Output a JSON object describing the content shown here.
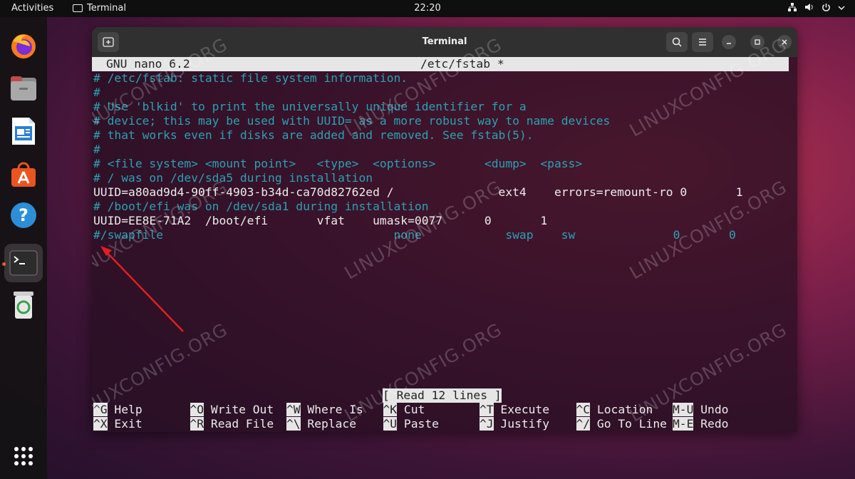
{
  "topbar": {
    "activities": "Activities",
    "app_name": "Terminal",
    "clock": "22:20"
  },
  "dock": {
    "items": [
      "Firefox",
      "Files",
      "LibreOffice Writer",
      "Ubuntu Software",
      "Help",
      "Terminal",
      "Trash"
    ]
  },
  "window": {
    "title": "Terminal"
  },
  "nano": {
    "version": "GNU nano 6.2",
    "filename": "/etc/fstab *",
    "lines": [
      "# /etc/fstab: static file system information.",
      "#",
      "# Use 'blkid' to print the universally unique identifier for a",
      "# device; this may be used with UUID= as a more robust way to name devices",
      "# that works even if disks are added and removed. See fstab(5).",
      "#",
      "# <file system> <mount point>   <type>  <options>       <dump>  <pass>",
      "# / was on /dev/sda5 during installation",
      "UUID=a80ad9d4-90ff-4903-b34d-ca70d82762ed /               ext4    errors=remount-ro 0       1",
      "# /boot/efi was on /dev/sda1 during installation",
      "UUID=EE8E-71A2  /boot/efi       vfat    umask=0077      0       1",
      "#/swapfile                                 none            swap    sw              0       0"
    ],
    "status": "[ Read 12 lines ]",
    "shortcuts_row1": [
      {
        "key": "^G",
        "label": "Help"
      },
      {
        "key": "^O",
        "label": "Write Out"
      },
      {
        "key": "^W",
        "label": "Where Is"
      },
      {
        "key": "^K",
        "label": "Cut"
      },
      {
        "key": "^T",
        "label": "Execute"
      },
      {
        "key": "^C",
        "label": "Location"
      },
      {
        "key": "M-U",
        "label": "Undo"
      }
    ],
    "shortcuts_row2": [
      {
        "key": "^X",
        "label": "Exit"
      },
      {
        "key": "^R",
        "label": "Read File"
      },
      {
        "key": "^\\",
        "label": "Replace"
      },
      {
        "key": "^U",
        "label": "Paste"
      },
      {
        "key": "^J",
        "label": "Justify"
      },
      {
        "key": "^/",
        "label": "Go To Line"
      },
      {
        "key": "M-E",
        "label": "Redo"
      }
    ]
  },
  "watermark": "LINUXCONFIG.ORG",
  "colors": {
    "comment": "#2aa1b3",
    "accent": "#e95420",
    "arrow": "#e0201e"
  }
}
